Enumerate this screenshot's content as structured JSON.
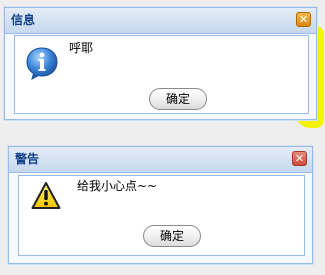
{
  "dialogs": [
    {
      "title": "信息",
      "message": "呼耶",
      "button_label": "确定",
      "close_symbol": "✕",
      "icon": "info-icon",
      "close_color": "#e39a22"
    },
    {
      "title": "警告",
      "message": "给我小心点~~",
      "button_label": "确定",
      "close_symbol": "✕",
      "icon": "warning-icon",
      "close_color": "#d9594b"
    }
  ],
  "colors": {
    "title_text": "#15428b",
    "window_border": "#99bbe8",
    "highlight": "#f4f400",
    "page_background": "#eeeeee"
  }
}
